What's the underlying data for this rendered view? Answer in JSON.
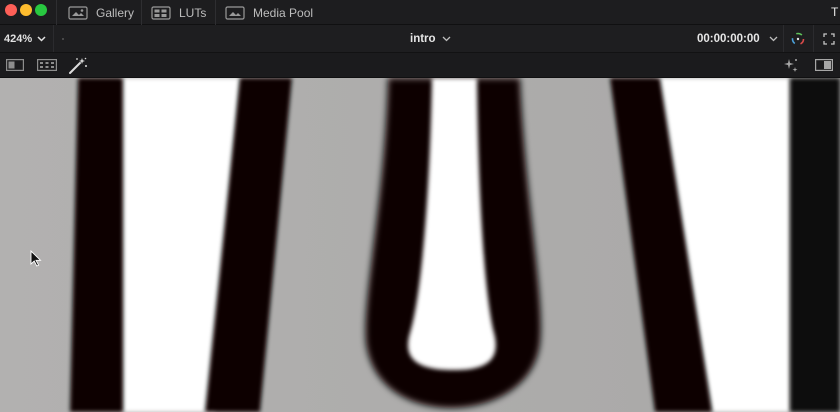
{
  "titlebar": {
    "tabs": [
      {
        "label": "Gallery",
        "icon": "gallery-icon"
      },
      {
        "label": "LUTs",
        "icon": "luts-icon"
      },
      {
        "label": "Media Pool",
        "icon": "media-pool-icon"
      }
    ],
    "right_text": "T"
  },
  "viewer_toolbar": {
    "zoom": "424%",
    "clip_name": "intro",
    "timecode": "00:00:00:00"
  },
  "colors": {
    "traffic_close": "#fe5f57",
    "traffic_minimize": "#febc2e",
    "traffic_maximize": "#28c840",
    "chrome_background": "#1d1d1f"
  }
}
